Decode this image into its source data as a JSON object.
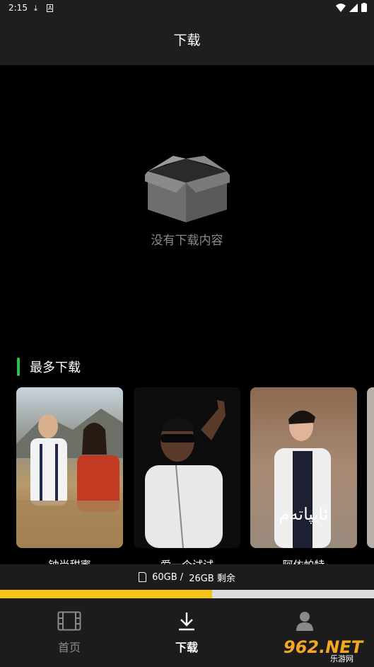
{
  "status_bar": {
    "time": "2:15"
  },
  "header": {
    "title": "下载"
  },
  "empty_state": {
    "message": "没有下载内容"
  },
  "most_downloaded": {
    "title": "最多下载",
    "items": [
      {
        "title": "钟尚甜蜜",
        "overlay": ""
      },
      {
        "title": "爱一个试试",
        "overlay": ""
      },
      {
        "title": "阿依帕特",
        "overlay": "ئايپاتەم"
      }
    ]
  },
  "storage": {
    "total": "60GB /",
    "remaining": "26GB 剩余",
    "used_fraction": 0.567
  },
  "tabbar": {
    "tabs": [
      {
        "label": "首页",
        "icon": "film-icon",
        "active": false
      },
      {
        "label": "下载",
        "icon": "download-icon",
        "active": true
      },
      {
        "label": "",
        "icon": "person-icon",
        "active": false
      }
    ]
  },
  "watermark": {
    "brand": "962.NET",
    "sub": "乐游网"
  },
  "colors": {
    "accent_green": "#2ec24a",
    "progress_yellow": "#f5c218",
    "bar_bg": "#1e1e1e"
  }
}
